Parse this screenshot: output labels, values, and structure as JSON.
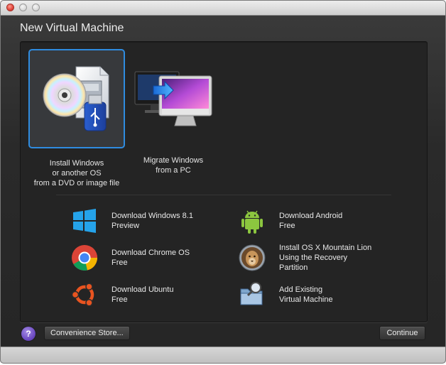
{
  "window": {
    "title": "New Virtual Machine"
  },
  "big_options": [
    {
      "label": "Install Windows\nor another OS\nfrom a DVD or image file",
      "selected": true,
      "icon": "dvd-usb-install-icon"
    },
    {
      "label": "Migrate Windows\nfrom a PC",
      "selected": false,
      "icon": "migrate-pc-to-mac-icon"
    }
  ],
  "small_options": [
    {
      "title": "Download Windows 8.1",
      "subtitle": "Preview",
      "icon": "windows-logo-icon"
    },
    {
      "title": "Download Android",
      "subtitle": "Free",
      "icon": "android-logo-icon"
    },
    {
      "title": "Download Chrome OS",
      "subtitle": "Free",
      "icon": "chrome-logo-icon"
    },
    {
      "title": "Install OS X Mountain Lion",
      "subtitle": "Using the Recovery\nPartition",
      "icon": "mountain-lion-icon"
    },
    {
      "title": "Download Ubuntu",
      "subtitle": "Free",
      "icon": "ubuntu-logo-icon"
    },
    {
      "title": "Add Existing",
      "subtitle": "Virtual Machine",
      "icon": "add-existing-vm-icon"
    }
  ],
  "footer": {
    "help_label": "?",
    "convenience_store_label": "Convenience Store...",
    "continue_label": "Continue"
  },
  "colors": {
    "selection_border": "#2f8ce0",
    "panel_bg": "#242424",
    "help_button": "#6a48c0"
  }
}
